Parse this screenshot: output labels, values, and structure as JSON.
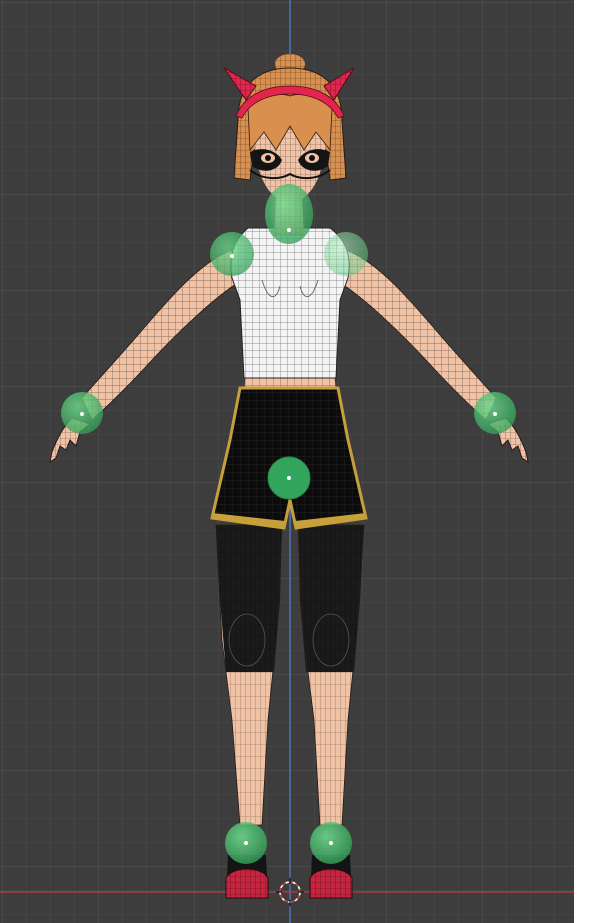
{
  "viewport": {
    "background": "#3d3d3d",
    "axis_y_color": "#4a7fd6",
    "axis_x_color": "#b43c4c"
  },
  "character": {
    "skin": "#f1c3a6",
    "hair": "#d98f4e",
    "headband": "#e2254d",
    "shirt": "#f4f4f4",
    "shorts": "#0c0c0c",
    "shorts_trim": "#c7a03a",
    "leggings": "#1a1a1a",
    "shoes": "#c8233f"
  },
  "controls": {
    "color": "#3fbf6a",
    "items": [
      {
        "name": "head-control-handle"
      },
      {
        "name": "left-shoulder-control-handle"
      },
      {
        "name": "right-shoulder-control-handle"
      },
      {
        "name": "left-hand-control-handle"
      },
      {
        "name": "right-hand-control-handle"
      },
      {
        "name": "hip-root-control-handle"
      },
      {
        "name": "left-foot-control-handle"
      },
      {
        "name": "right-foot-control-handle"
      }
    ]
  },
  "cursor_3d": {
    "icon": "3d-cursor-icon"
  }
}
